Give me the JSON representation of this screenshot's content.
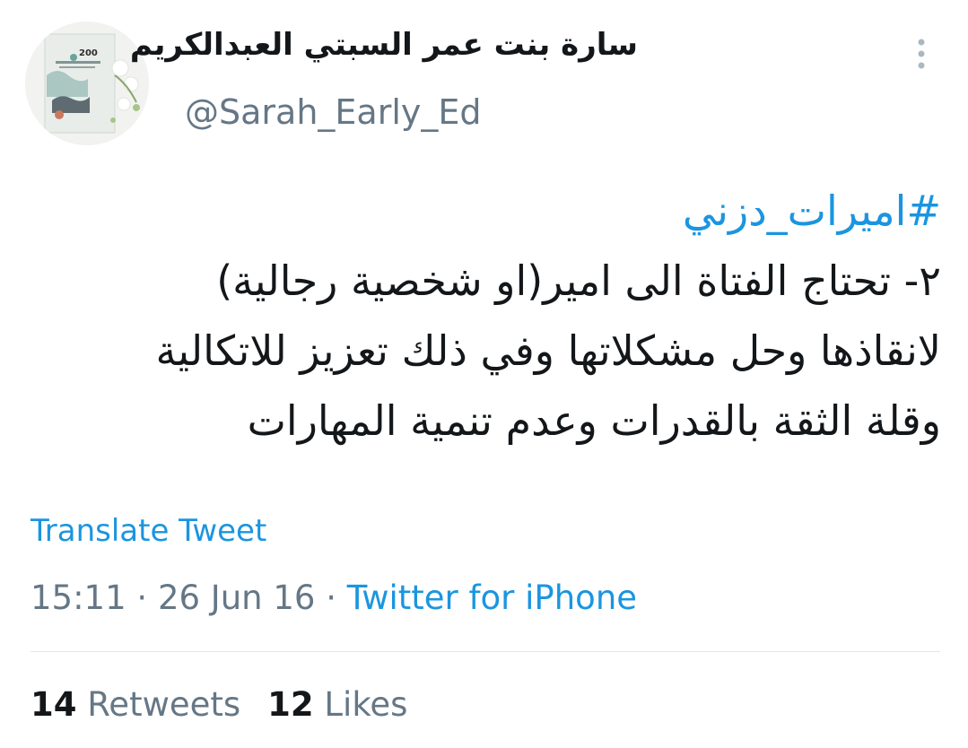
{
  "user": {
    "display_name": "سارة بنت عمر السبتي العبدالكريم",
    "handle": "@Sarah_Early_Ed",
    "avatar_text": "200"
  },
  "tweet": {
    "hashtag": "#اميرات_دزني",
    "lines": [
      "٢- تحتاج الفتاة الى امير(او شخصية رجالية)",
      "لانقاذها وحل مشكلاتها وفي ذلك تعزيز للاتكالية",
      "وقلة الثقة بالقدرات وعدم تنمية المهارات"
    ]
  },
  "translate_label": "Translate Tweet",
  "meta": {
    "time": "15:11",
    "separator": "·",
    "date": "26 Jun 16",
    "source": "Twitter for iPhone"
  },
  "stats": {
    "retweets_count": "14",
    "retweets_label": "Retweets",
    "likes_count": "12",
    "likes_label": "Likes"
  },
  "colors": {
    "link": "#1b95e0",
    "secondary_text": "#657786",
    "primary_text": "#14171a",
    "divider": "#e1e8ed"
  },
  "icons": {
    "more": "vertical-ellipsis-icon"
  }
}
